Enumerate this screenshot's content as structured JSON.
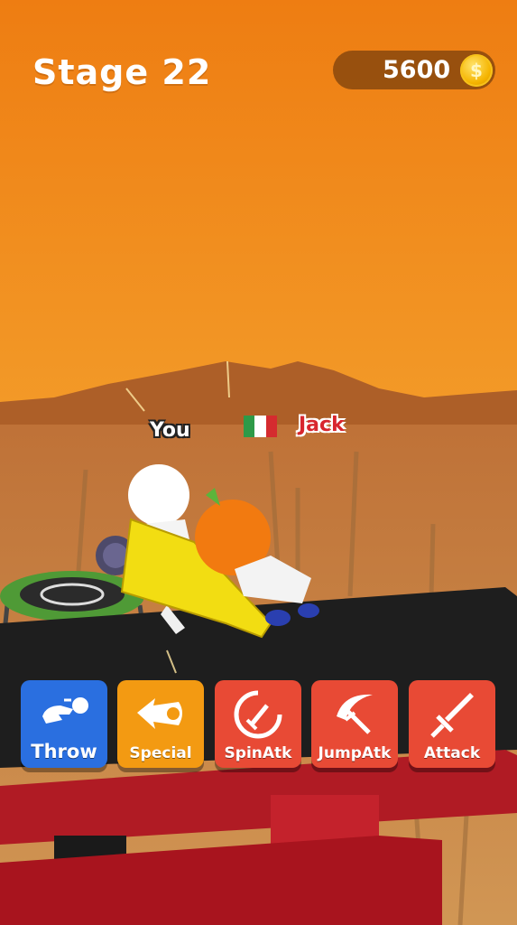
{
  "hud": {
    "stage_label": "Stage 22",
    "coins": "5600",
    "coin_symbol": "$"
  },
  "players": {
    "player_name": "You",
    "opponent_name": "Jack",
    "opponent_flag": "italy-flag-icon"
  },
  "actions": [
    {
      "label": "Throw",
      "icon": "throw-icon",
      "color": "#2a6fe0"
    },
    {
      "label": "Special",
      "icon": "special-icon",
      "color": "#f39a12"
    },
    {
      "label": "SpinAtk",
      "icon": "spin-attack-icon",
      "color": "#e84a35"
    },
    {
      "label": "JumpAtk",
      "icon": "jump-attack-icon",
      "color": "#e84a35"
    },
    {
      "label": "Attack",
      "icon": "sword-icon",
      "color": "#e84a35"
    }
  ],
  "colors": {
    "sky_top": "#ef7f12",
    "sky_bottom": "#f7a83a",
    "mountains": "#b0622a",
    "platform": "#202020",
    "torii_red": "#b81c25",
    "player_white": "#ffffff",
    "opponent_head": "#f27a10",
    "weapon_yellow": "#f2de12"
  }
}
